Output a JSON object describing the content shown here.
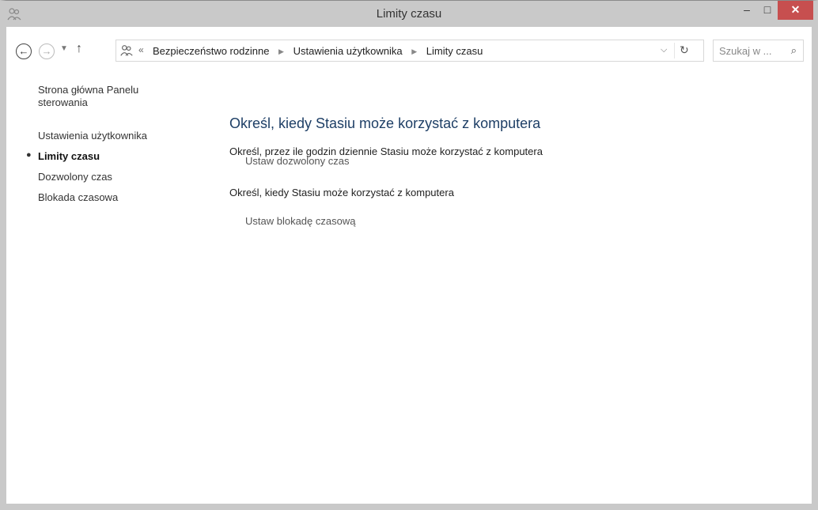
{
  "window": {
    "title": "Limity czasu",
    "minimize": "–",
    "maximize": "□",
    "close": "✕"
  },
  "nav": {
    "back_icon": "back-arrow-icon",
    "forward_icon": "forward-arrow-icon",
    "up_icon": "up-arrow-icon"
  },
  "address": {
    "overflow": "«",
    "crumbs": [
      "Bezpieczeństwo rodzinne",
      "Ustawienia użytkownika",
      "Limity czasu"
    ]
  },
  "search": {
    "placeholder": "Szukaj w ..."
  },
  "sidebar": {
    "home": "Strona główna Panelu sterowania",
    "items": [
      {
        "label": "Ustawienia użytkownika",
        "active": false
      },
      {
        "label": "Limity czasu",
        "active": true
      },
      {
        "label": "Dozwolony czas",
        "active": false
      },
      {
        "label": "Blokada czasowa",
        "active": false
      }
    ]
  },
  "main": {
    "heading": "Określ, kiedy Stasiu może korzystać z komputera",
    "sections": [
      {
        "title": "Określ, przez ile godzin dziennie Stasiu może korzystać z komputera",
        "link": "Ustaw dozwolony czas"
      },
      {
        "title": "Określ, kiedy Stasiu może korzystać z komputera",
        "link": "Ustaw blokadę czasową"
      }
    ]
  },
  "colors": {
    "titlebar": "#c9c9c9",
    "close_button": "#c74f4f",
    "heading": "#1e3f66"
  }
}
